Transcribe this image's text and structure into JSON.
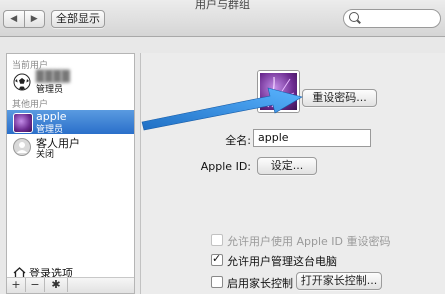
{
  "window": {
    "title": "用户与群组"
  },
  "toolbar": {
    "back": "◀",
    "forward": "▶",
    "show_all": "全部显示",
    "search_placeholder": ""
  },
  "sidebar": {
    "section_current": "当前用户",
    "section_other": "其他用户",
    "users": [
      {
        "name": "",
        "role": "管理员",
        "avatar": "soccer-ball"
      },
      {
        "name": "apple",
        "role": "管理员",
        "avatar": "purple-flower"
      },
      {
        "name": "客人用户",
        "role": "关闭",
        "avatar": "guest-silhouette"
      }
    ],
    "login_options": "登录选项",
    "add": "+",
    "remove": "−",
    "action": "✱"
  },
  "main": {
    "reset_password": "重设密码...",
    "full_name_label": "全名:",
    "full_name_value": "apple",
    "apple_id_label": "Apple ID:",
    "apple_id_button": "设定...",
    "allow_apple_id_reset": "允许用户使用 Apple ID 重设密码",
    "allow_admin": "允许用户管理这台电脑",
    "enable_parental": "启用家长控制",
    "open_parental": "打开家长控制..."
  },
  "colors": {
    "selection": "#3579d0",
    "arrow": "#2f8fe0"
  }
}
